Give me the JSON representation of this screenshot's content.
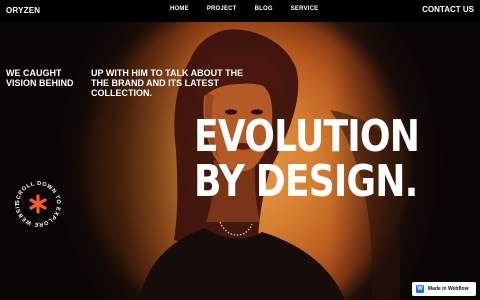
{
  "brand": {
    "logo": "ORYZEN"
  },
  "nav": {
    "items": [
      {
        "label": "HOME"
      },
      {
        "label": "PROJECT"
      },
      {
        "label": "BLOG"
      },
      {
        "label": "SERVICE"
      }
    ],
    "contact": "CONTACT US"
  },
  "hero": {
    "intro_left": "WE CAUGHT VISION BEHIND",
    "intro_right": "UP WITH HIM TO TALK ABOUT THE THE BRAND AND ITS LATEST COLLECTION.",
    "headline_line1": "EVOLUTION",
    "headline_line2": "BY DESIGN."
  },
  "scroll_badge": {
    "text": "SCROLL DOWN TO EXPLORE WEBSITE",
    "icon": "asterisk-icon",
    "accent": "#ff5a1f"
  },
  "webflow": {
    "label": "Made in Webflow"
  },
  "colors": {
    "background": "#0b0706",
    "spotlight": "#d77d2f",
    "nav_bg": "#000000",
    "text": "#ffffff"
  }
}
